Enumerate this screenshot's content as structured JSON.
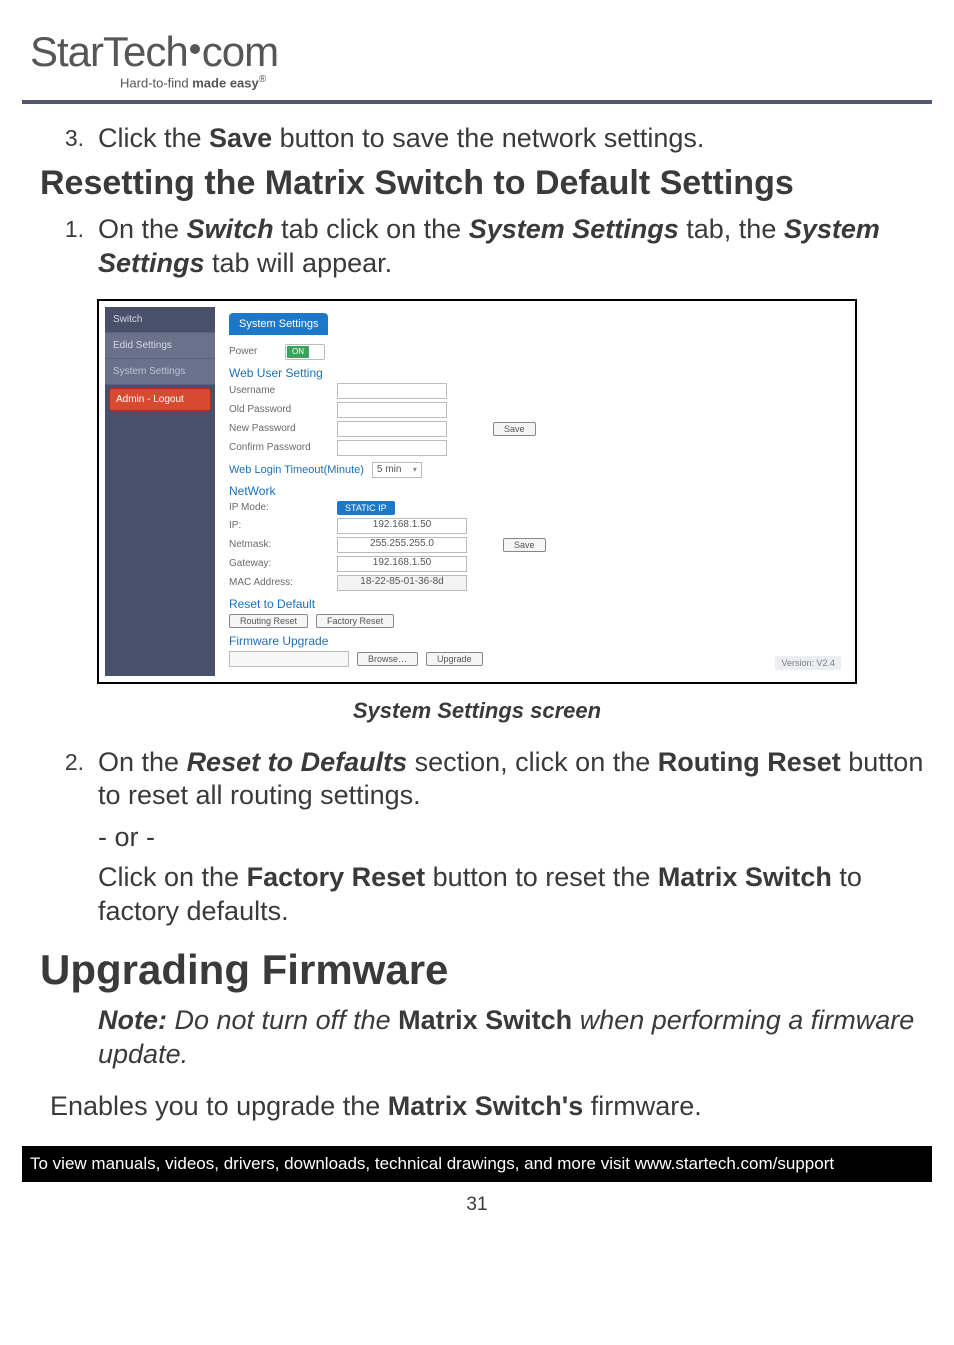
{
  "logo": {
    "part1": "StarTech",
    "part2": "com",
    "tag_pre": "Hard-to-find ",
    "tag_bold": "made easy",
    "tag_reg": "®"
  },
  "step3": {
    "num": "3.",
    "pre": "Click the ",
    "bold": "Save",
    "post": " button to save the network settings."
  },
  "h2_reset": "Resetting the Matrix Switch to Default Settings",
  "step1": {
    "num": "1.",
    "t1": "On the ",
    "bi1": "Switch",
    "t2": " tab click on the ",
    "bi2": "System Settings",
    "t3": " tab, the ",
    "bi3": "System Settings",
    "t4": " tab will appear."
  },
  "shot": {
    "sidebar": {
      "switch": "Switch",
      "edid": "Edid Settings",
      "system": "System Settings",
      "logout": "Admin - Logout"
    },
    "tab": "System Settings",
    "power_label": "Power",
    "power_state": "ON",
    "web_user_setting": "Web User Setting",
    "username": "Username",
    "old_pw": "Old Password",
    "new_pw": "New Password",
    "confirm_pw": "Confirm Password",
    "save": "Save",
    "timeout_label": "Web Login Timeout(Minute)",
    "timeout_value": "5 min",
    "network": "NetWork",
    "ip_mode_label": "IP Mode:",
    "ip_mode_value": "STATIC IP",
    "ip_label": "IP:",
    "ip_value": "192.168.1.50",
    "netmask_label": "Netmask:",
    "netmask_value": "255.255.255.0",
    "gateway_label": "Gateway:",
    "gateway_value": "192.168.1.50",
    "mac_label": "MAC Address:",
    "mac_value": "18-22-85-01-36-8d",
    "reset_title": "Reset to Default",
    "routing_reset": "Routing Reset",
    "factory_reset": "Factory Reset",
    "fw_title": "Firmware Upgrade",
    "browse": "Browse…",
    "upgrade": "Upgrade",
    "version": "Version: V2.4"
  },
  "caption": "System Settings screen",
  "step2": {
    "num": "2.",
    "t1": "On the ",
    "bi1": "Reset to Defaults",
    "t2": " section, click on the ",
    "b1": "Routing Reset",
    "t3": " button to reset all routing settings."
  },
  "or_text": "- or -",
  "step2b": {
    "t1": "Click on the ",
    "b1": "Factory Reset",
    "t2": " button to reset the ",
    "b2": "Matrix Switch",
    "t3": " to factory defaults."
  },
  "h1_upgrade": "Upgrading Firmware",
  "note": {
    "bi1": "Note:",
    "i1": " Do not turn off the ",
    "b1": "Matrix Switch",
    "i2": " when performing a firmware update."
  },
  "enables": {
    "t1": "Enables you to upgrade the ",
    "b1": "Matrix Switch's",
    "t2": " firmware."
  },
  "footer": "To view manuals, videos, drivers, downloads, technical drawings, and more visit www.startech.com/support",
  "page_num": "31"
}
